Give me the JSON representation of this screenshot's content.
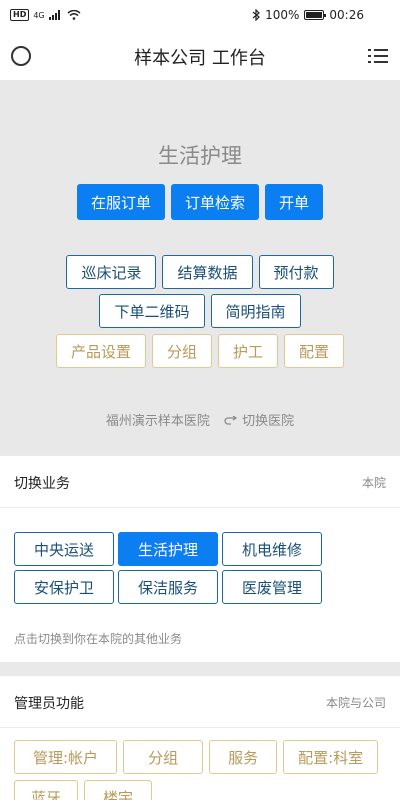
{
  "status": {
    "battery": "100%",
    "time": "00:26",
    "hd": "HD",
    "net": "4G"
  },
  "header": {
    "title": "样本公司 工作台"
  },
  "hero": {
    "title": "生活护理",
    "primary": [
      "在服订单",
      "订单检索",
      "开单"
    ],
    "outline_row1": [
      "巡床记录",
      "结算数据",
      "预付款"
    ],
    "outline_row2": [
      "下单二维码",
      "简明指南"
    ],
    "gold_row": [
      "产品设置",
      "分组",
      "护工",
      "配置"
    ],
    "hospital": "福州演示样本医院",
    "switch_hospital": "切换医院"
  },
  "business": {
    "title": "切换业务",
    "meta": "本院",
    "items": [
      "中央运送",
      "生活护理",
      "机电维修",
      "安保护卫",
      "保洁服务",
      "医废管理"
    ],
    "active_index": 1,
    "hint": "点击切换到你在本院的其他业务"
  },
  "admin": {
    "title": "管理员功能",
    "meta": "本院与公司",
    "items": [
      "管理:帐户",
      "分组",
      "服务",
      "配置:科室",
      "蓝牙",
      "楼宇"
    ]
  }
}
